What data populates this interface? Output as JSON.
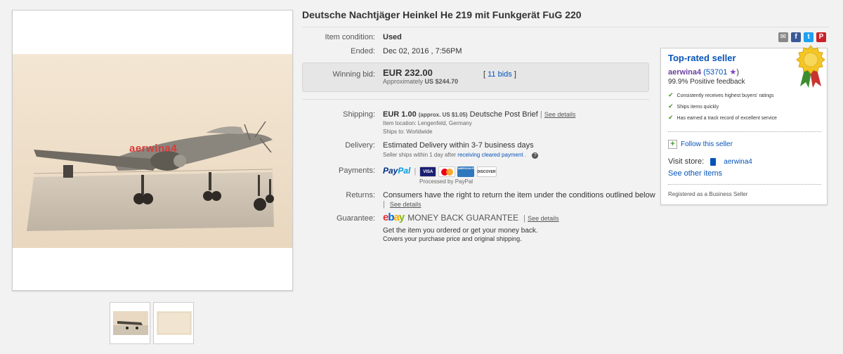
{
  "listing": {
    "title": "Deutsche Nachtjäger Heinkel He 219 mit Funkgerät FuG 220"
  },
  "photo": {
    "watermark": "aerwina4"
  },
  "details": {
    "condition_label": "Item condition:",
    "condition_value": "Used",
    "ended_label": "Ended:",
    "ended_value": "Dec 02, 2016 , 7:56PM",
    "winning_bid_label": "Winning bid:",
    "winning_bid_value": "EUR 232.00",
    "approx_prefix": "Approximately",
    "approx_value": "US $244.70",
    "bids_text": "11 bids",
    "shipping_label": "Shipping:",
    "shipping_cost": "EUR 1.00",
    "shipping_approx": "(approx. US $1.05)",
    "shipping_service": "Deutsche Post Brief",
    "see_details": "See details",
    "item_location": "Item location:  Lengenfeld, Germany",
    "ships_to": "Ships to:  Worldwide",
    "delivery_label": "Delivery:",
    "delivery_value": "Estimated Delivery within 3-7 business days",
    "delivery_note_prefix": "Seller ships within 1 day after",
    "delivery_note_link": "receiving cleared payment",
    "payments_label": "Payments:",
    "paypal_a": "Pay",
    "paypal_b": "Pal",
    "processed_by": "Processed by PayPal",
    "returns_label": "Returns:",
    "returns_value": "Consumers have the right to return the item under the conditions outlined below",
    "guarantee_label": "Guarantee:",
    "guarantee_value": "MONEY BACK GUARANTEE",
    "guarantee_line1": "Get the item you ordered or get your money back.",
    "guarantee_line2": "Covers your purchase price and original shipping."
  },
  "cards": {
    "visa": "VISA",
    "amex": "AMERICAN EXPRESS",
    "discover": "DISCOVER"
  },
  "ebay": {
    "e": "e",
    "b": "b",
    "a": "a",
    "y": "y"
  },
  "share": {
    "mail": "✉",
    "facebook": "f",
    "twitter": "t",
    "pinterest": "P"
  },
  "seller": {
    "badge": "Top-rated seller",
    "name": "aerwina4",
    "score": "(53701",
    "score_close": ")",
    "feedback": "99.9% Positive feedback",
    "bullets": [
      "Consistently receives highest buyers' ratings",
      "Ships items quickly",
      "Has earned a track record of excellent service"
    ],
    "follow": "Follow this seller",
    "visit_store_label": "Visit store:",
    "store_name": "aerwina4",
    "other_items": "See other items",
    "registered": "Registered as a Business Seller"
  },
  "colors": {
    "link": "#0654ba",
    "title": "#333333",
    "bid_box": "#e6e6e6"
  }
}
